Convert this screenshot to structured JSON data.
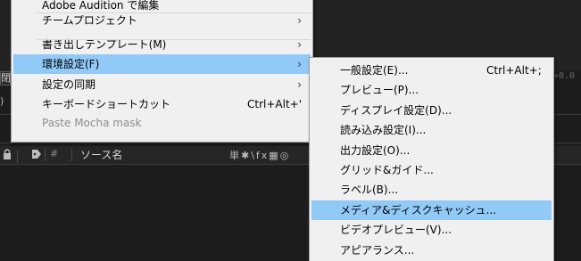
{
  "background": {
    "right_value": "+0.0",
    "left_stub": "閉",
    "left_stub2": ")",
    "timeline_header": {
      "icons": [
        "lock-icon",
        "label-tag-icon"
      ],
      "hash": "#",
      "source_name": "ソース名",
      "switches": "単✱\\fx▦◎"
    }
  },
  "main_menu": {
    "items": [
      {
        "label": "Adobe Audition で編集",
        "shortcut": "",
        "submenu": false,
        "highlighted": false,
        "disabled": false
      },
      {
        "label": "チームプロジェクト",
        "shortcut": "",
        "submenu": true,
        "highlighted": false,
        "disabled": false
      },
      {
        "label": "書き出しテンプレート(M)",
        "shortcut": "",
        "submenu": true,
        "highlighted": false,
        "disabled": false
      },
      {
        "label": "環境設定(F)",
        "shortcut": "",
        "submenu": true,
        "highlighted": true,
        "disabled": false
      },
      {
        "label": "設定の同期",
        "shortcut": "",
        "submenu": true,
        "highlighted": false,
        "disabled": false
      },
      {
        "label": "キーボードショートカット",
        "shortcut": "Ctrl+Alt+'",
        "submenu": false,
        "highlighted": false,
        "disabled": false
      },
      {
        "label": "Paste Mocha mask",
        "shortcut": "",
        "submenu": false,
        "highlighted": false,
        "disabled": true
      }
    ]
  },
  "sub_menu": {
    "items": [
      {
        "label": "一般設定(E)...",
        "shortcut": "Ctrl+Alt+;",
        "highlighted": false
      },
      {
        "label": "プレビュー(P)...",
        "shortcut": "",
        "highlighted": false
      },
      {
        "label": "ディスプレイ設定(D)...",
        "shortcut": "",
        "highlighted": false
      },
      {
        "label": "読み込み設定(I)...",
        "shortcut": "",
        "highlighted": false
      },
      {
        "label": "出力設定(O)...",
        "shortcut": "",
        "highlighted": false
      },
      {
        "label": "グリッド&ガイド...",
        "shortcut": "",
        "highlighted": false
      },
      {
        "label": "ラベル(B)...",
        "shortcut": "",
        "highlighted": false
      },
      {
        "label": "メディア&ディスクキャッシュ...",
        "shortcut": "",
        "highlighted": true
      },
      {
        "label": "ビデオプレビュー(V)...",
        "shortcut": "",
        "highlighted": false
      },
      {
        "label": "アピアランス...",
        "shortcut": "",
        "highlighted": false
      }
    ]
  },
  "colors": {
    "menu_bg": "#f0f0f0",
    "highlight": "#91c9f7",
    "disabled_text": "#8d8d8d",
    "app_bg": "#1d1d1d"
  }
}
